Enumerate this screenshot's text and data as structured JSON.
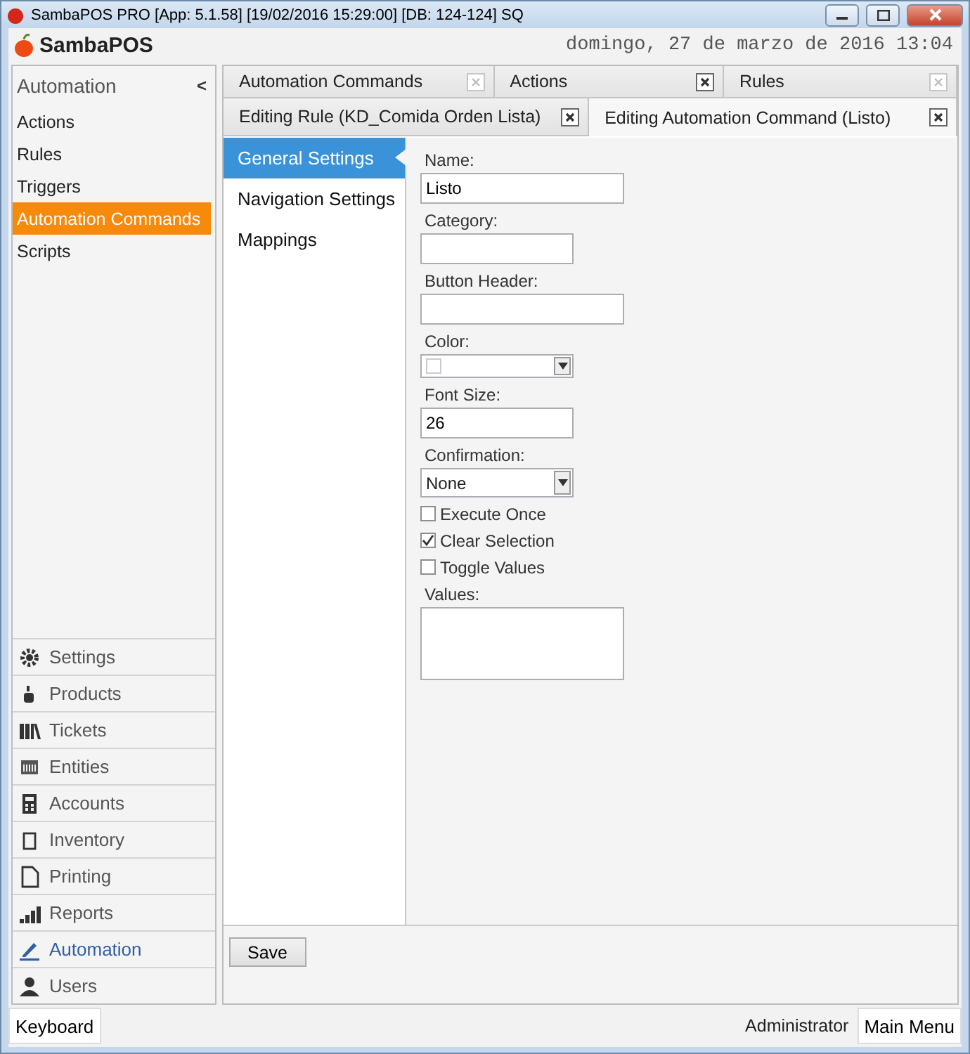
{
  "window": {
    "title": "SambaPOS PRO [App: 5.1.58] [19/02/2016 15:29:00] [DB: 124-124] SQ"
  },
  "header": {
    "logo": "SambaPOS",
    "date": "domingo, 27 de marzo de 2016 13:04"
  },
  "sidebar": {
    "title": "Automation",
    "collapse": "<",
    "items": [
      {
        "label": "Actions",
        "selected": false
      },
      {
        "label": "Rules",
        "selected": false
      },
      {
        "label": "Triggers",
        "selected": false
      },
      {
        "label": "Automation Commands",
        "selected": true
      },
      {
        "label": "Scripts",
        "selected": false
      }
    ],
    "modules": [
      {
        "label": "Settings",
        "selected": false
      },
      {
        "label": "Products",
        "selected": false
      },
      {
        "label": "Tickets",
        "selected": false
      },
      {
        "label": "Entities",
        "selected": false
      },
      {
        "label": "Accounts",
        "selected": false
      },
      {
        "label": "Inventory",
        "selected": false
      },
      {
        "label": "Printing",
        "selected": false
      },
      {
        "label": "Reports",
        "selected": false
      },
      {
        "label": "Automation",
        "selected": true
      },
      {
        "label": "Users",
        "selected": false
      }
    ]
  },
  "tabs": [
    [
      {
        "label": "Automation Commands",
        "selected": false,
        "close_active": false
      },
      {
        "label": "Actions",
        "selected": false,
        "close_active": true
      },
      {
        "label": "Rules",
        "selected": false,
        "close_active": false
      }
    ],
    [
      {
        "label": "Editing Rule (KD_Comida Orden Lista)",
        "selected": false,
        "close_active": true
      },
      {
        "label": "Editing Automation Command (Listo)",
        "selected": true,
        "close_active": true
      }
    ]
  ],
  "sections": [
    {
      "label": "General Settings",
      "selected": true
    },
    {
      "label": "Navigation Settings",
      "selected": false
    },
    {
      "label": "Mappings",
      "selected": false
    }
  ],
  "fields": [
    {
      "kind": "text",
      "label": "Name:",
      "value": "Listo",
      "wide": true
    },
    {
      "kind": "text",
      "label": "Category:",
      "wide": false
    },
    {
      "kind": "text",
      "label": "Button Header:",
      "wide": true
    },
    {
      "kind": "color",
      "label": "Color:"
    },
    {
      "kind": "text",
      "label": "Font Size:",
      "value": "26",
      "wide": false
    },
    {
      "kind": "select",
      "label": "Confirmation:",
      "value": "None"
    },
    {
      "kind": "checkbox",
      "label": "Execute Once",
      "checked": false
    },
    {
      "kind": "checkbox",
      "label": "Clear Selection",
      "checked": true
    },
    {
      "kind": "checkbox",
      "label": "Toggle Values",
      "checked": false
    },
    {
      "kind": "textarea",
      "label": "Values:"
    }
  ],
  "save_button": "Save",
  "status_bar": {
    "keyboard": "Keyboard",
    "user": "Administrator",
    "main_menu": "Main Menu"
  }
}
